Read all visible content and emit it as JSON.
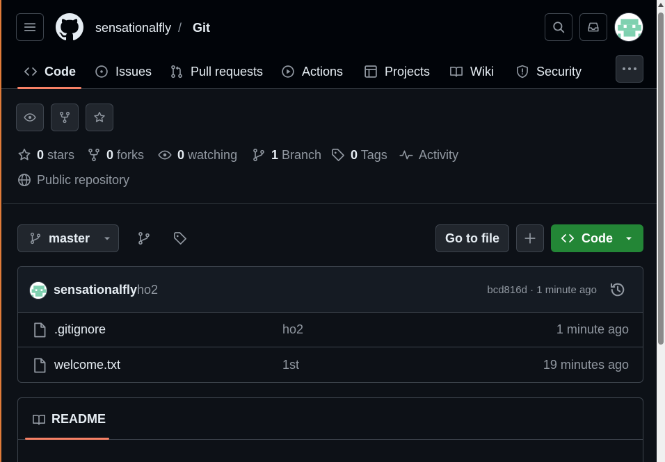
{
  "header": {
    "owner": "sensationalfly",
    "separator": "/",
    "repo": "Git"
  },
  "nav": {
    "tabs": [
      {
        "label": "Code",
        "icon": "code-icon",
        "active": true
      },
      {
        "label": "Issues",
        "icon": "issue-icon"
      },
      {
        "label": "Pull requests",
        "icon": "pull-request-icon"
      },
      {
        "label": "Actions",
        "icon": "play-icon"
      },
      {
        "label": "Projects",
        "icon": "table-icon"
      },
      {
        "label": "Wiki",
        "icon": "book-icon"
      },
      {
        "label": "Security",
        "icon": "shield-icon"
      }
    ]
  },
  "stats": {
    "stars_count": "0",
    "stars_label": "stars",
    "forks_count": "0",
    "forks_label": "forks",
    "watching_count": "0",
    "watching_label": "watching",
    "branch_count": "1",
    "branch_label": "Branch",
    "tags_count": "0",
    "tags_label": "Tags",
    "activity_label": "Activity",
    "visibility": "Public repository"
  },
  "toolbar": {
    "branch": "master",
    "goto_file": "Go to file",
    "code_button": "Code"
  },
  "latest_commit": {
    "author": "sensationalfly",
    "message": "ho2",
    "meta": "bcd816d · 1 minute ago"
  },
  "files": [
    {
      "name": ".gitignore",
      "commit": "ho2",
      "age": "1 minute ago"
    },
    {
      "name": "welcome.txt",
      "commit": "1st",
      "age": "19 minutes ago"
    }
  ],
  "readme": {
    "tab_label": "README"
  },
  "colors": {
    "accent_underline": "#f78166",
    "code_button": "#238636",
    "background": "#0d1117"
  }
}
